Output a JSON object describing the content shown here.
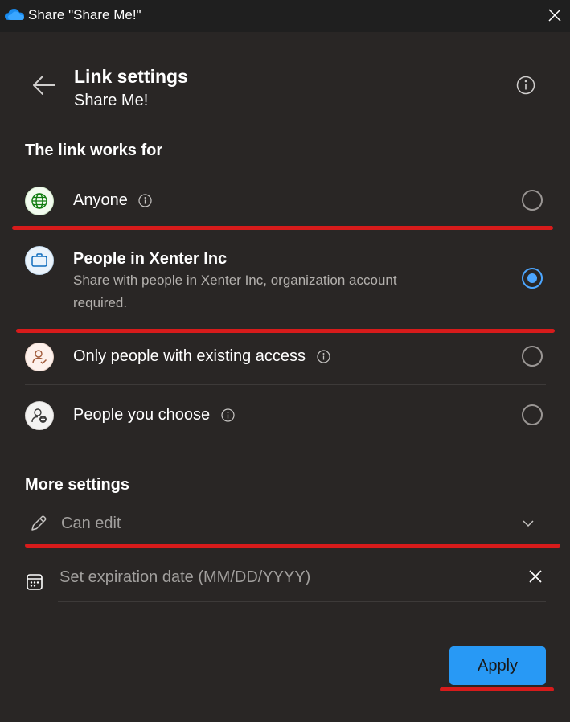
{
  "window": {
    "title": "Share \"Share Me!\""
  },
  "header": {
    "title": "Link settings",
    "subtitle": "Share Me!"
  },
  "link_works_for": {
    "heading": "The link works for",
    "options": [
      {
        "label": "Anyone",
        "selected": false,
        "icon": "globe-icon"
      },
      {
        "label": "People in Xenter Inc",
        "description": "Share with people in Xenter Inc, organization account required.",
        "selected": true,
        "icon": "briefcase-icon"
      },
      {
        "label": "Only people with existing access",
        "selected": false,
        "icon": "person-check-icon"
      },
      {
        "label": "People you choose",
        "selected": false,
        "icon": "person-add-icon"
      }
    ]
  },
  "more_settings": {
    "heading": "More settings",
    "permission": "Can edit",
    "expiration_placeholder": "Set expiration date (MM/DD/YYYY)"
  },
  "footer": {
    "apply_label": "Apply"
  },
  "colors": {
    "accent": "#2899f5",
    "radio_selected": "#4ca6ff",
    "annotation": "#d71b1b",
    "panel_bg": "#292625"
  }
}
